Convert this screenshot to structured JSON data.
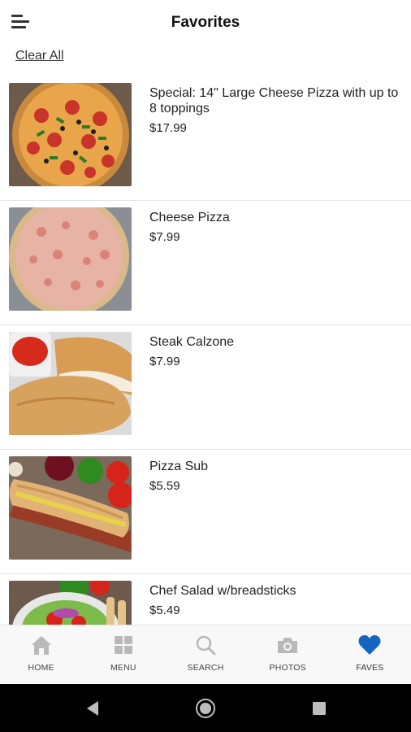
{
  "header": {
    "title": "Favorites",
    "menu_icon": "hamburger-icon"
  },
  "clear_all": "Clear All",
  "items": [
    {
      "name": "Special: 14\" Large Cheese Pizza with up to\n8 toppings",
      "price": "$17.99",
      "image": "supreme-pizza"
    },
    {
      "name": "Cheese Pizza",
      "price": "$7.99",
      "image": "cheese-pizza"
    },
    {
      "name": "Steak Calzone",
      "price": "$7.99",
      "image": "calzone"
    },
    {
      "name": "Pizza Sub",
      "price": "$5.59",
      "image": "sub-sandwich"
    },
    {
      "name": "Chef Salad w/breadsticks",
      "price": "$5.49",
      "image": "salad"
    }
  ],
  "tabs": [
    {
      "label": "HOME",
      "icon": "home-icon",
      "active": false
    },
    {
      "label": "MENU",
      "icon": "grid-icon",
      "active": false
    },
    {
      "label": "SEARCH",
      "icon": "search-icon",
      "active": false
    },
    {
      "label": "PHOTOS",
      "icon": "camera-icon",
      "active": false
    },
    {
      "label": "FAVES",
      "icon": "heart-icon",
      "active": true
    }
  ],
  "colors": {
    "active": "#1565c0",
    "inactive_icon": "#b9b9b9",
    "tabbar_bg": "#f8f8f8",
    "system_nav_bg": "#000000"
  },
  "system_nav": {
    "back_icon": "back-icon",
    "home_icon": "home-circle-icon",
    "recents_icon": "recents-icon"
  }
}
